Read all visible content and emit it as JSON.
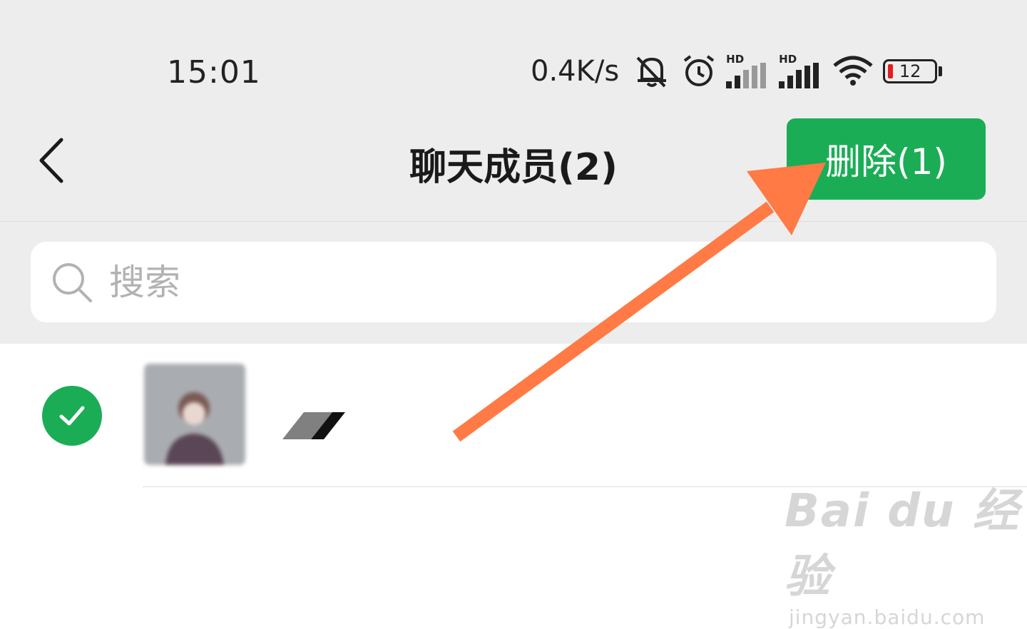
{
  "status_bar": {
    "time": "15:01",
    "net_speed": "0.4K/s",
    "signal_1_label": "HD",
    "signal_2_label": "HD",
    "battery_level": "12",
    "icons": [
      "mute-bell-icon",
      "alarm-icon",
      "signal-icon",
      "wifi-icon",
      "battery-icon"
    ]
  },
  "header": {
    "title": "聊天成员(2)",
    "delete_label": "删除(1)",
    "back_icon": "chevron-left-icon"
  },
  "search": {
    "placeholder": "搜索",
    "value": ""
  },
  "members": [
    {
      "name": "◢",
      "selected": true
    }
  ],
  "watermark": {
    "logo": "Bai du 经验",
    "url": "jingyan.baidu.com"
  },
  "colors": {
    "accent_green": "#1aad55",
    "annotation_arrow": "#ff7a45",
    "header_bg": "#ededed"
  }
}
